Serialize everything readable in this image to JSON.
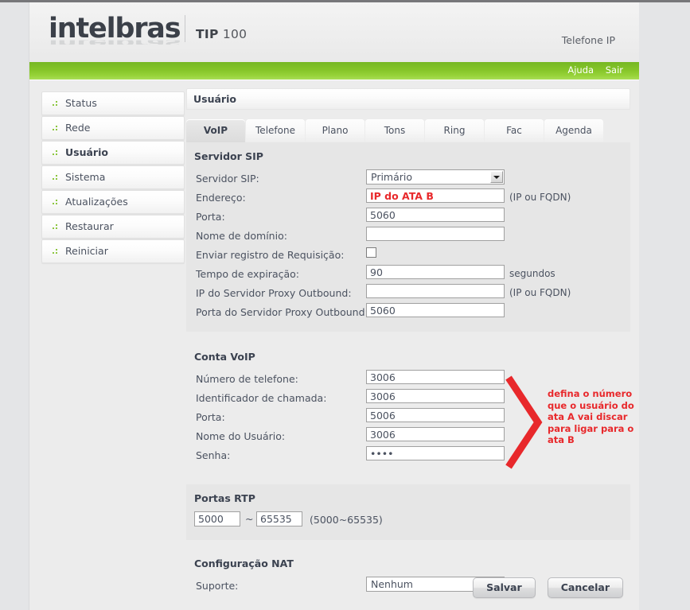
{
  "header": {
    "logo": "intelbras",
    "model_bold": "TIP",
    "model_num": "100",
    "device_type": "Telefone IP",
    "help_link": "Ajuda",
    "logout_link": "Sair"
  },
  "sidebar": {
    "items": [
      {
        "label": "Status",
        "active": false
      },
      {
        "label": "Rede",
        "active": false
      },
      {
        "label": "Usuário",
        "active": true
      },
      {
        "label": "Sistema",
        "active": false
      },
      {
        "label": "Atualizações",
        "active": false
      },
      {
        "label": "Restaurar",
        "active": false
      },
      {
        "label": "Reiniciar",
        "active": false
      }
    ]
  },
  "panel": {
    "title": "Usuário"
  },
  "tabs": [
    {
      "label": "VoIP",
      "active": true
    },
    {
      "label": "Telefone",
      "active": false
    },
    {
      "label": "Plano",
      "active": false
    },
    {
      "label": "Tons",
      "active": false
    },
    {
      "label": "Ring",
      "active": false
    },
    {
      "label": "Fac",
      "active": false
    },
    {
      "label": "Agenda",
      "active": false
    }
  ],
  "sip_section": {
    "title": "Servidor SIP",
    "server_label": "Servidor SIP:",
    "server_value": "Primário",
    "address_label": "Endereço:",
    "address_value": "IP do ATA B",
    "address_hint": "(IP ou FQDN)",
    "port_label": "Porta:",
    "port_value": "5060",
    "domain_label": "Nome de domínio:",
    "domain_value": "",
    "register_label": "Enviar registro de Requisição:",
    "expire_label": "Tempo de expiração:",
    "expire_value": "90",
    "expire_unit": "segundos",
    "proxy_ip_label": "IP do Servidor Proxy Outbound:",
    "proxy_ip_value": "",
    "proxy_ip_hint": "(IP ou FQDN)",
    "proxy_port_label": "Porta do Servidor Proxy Outbound:",
    "proxy_port_value": "5060"
  },
  "account_section": {
    "title": "Conta VoIP",
    "phone_label": "Número de telefone:",
    "phone_value": "3006",
    "callerid_label": "Identificador de chamada:",
    "callerid_value": "3006",
    "port_label": "Porta:",
    "port_value": "5006",
    "username_label": "Nome do Usuário:",
    "username_value": "3006",
    "password_label": "Senha:",
    "password_value": "••••"
  },
  "annotation": {
    "text": "defina o número que o usuário do ata A vai discar para ligar para o ata B",
    "color": "#e8282b"
  },
  "rtp_section": {
    "title": "Portas RTP",
    "start_value": "5000",
    "separator": "~",
    "end_value": "65535",
    "range_hint": "(5000~65535)"
  },
  "nat_section": {
    "title": "Configuração NAT",
    "support_label": "Suporte:",
    "support_value": "Nenhum"
  },
  "footer": {
    "save_label": "Salvar",
    "cancel_label": "Cancelar"
  },
  "colors": {
    "brand_green": "#84c427",
    "accent_red": "#e8282b",
    "text": "#4b5260"
  }
}
